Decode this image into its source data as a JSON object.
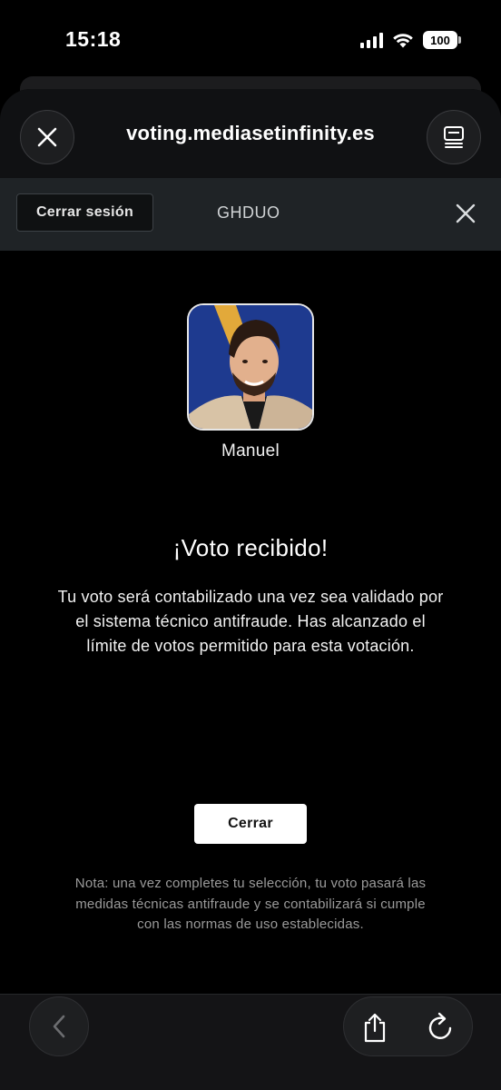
{
  "status_bar": {
    "time": "15:18",
    "battery": "100"
  },
  "browser": {
    "url": "voting.mediasetinfinity.es",
    "close_icon": "close-icon",
    "tabs_icon": "tabs-icon"
  },
  "site_toolbar": {
    "logout_label": "Cerrar sesión",
    "code": "GHDUO",
    "close_icon": "close-icon"
  },
  "candidate": {
    "name": "Manuel"
  },
  "confirmation": {
    "title": "¡Voto recibido!",
    "message": "Tu voto será contabilizado una vez sea validado por el sistema técnico antifraude. Has alcanzado el límite de votos permitido para esta votación.",
    "close_label": "Cerrar",
    "note": "Nota: una vez completes tu selección, tu voto pasará las medidas técnicas antifraude y se contabilizará si cumple con las normas de uso establecidas."
  },
  "bottom_bar": {
    "back_icon": "chevron-left-icon",
    "share_icon": "share-icon",
    "reload_icon": "reload-icon"
  },
  "colors": {
    "background": "#000000",
    "header": "#101113",
    "site_bar": "#1f2326",
    "avatar_bg": "#1e3a8f",
    "note_text": "#9a9a9a"
  }
}
